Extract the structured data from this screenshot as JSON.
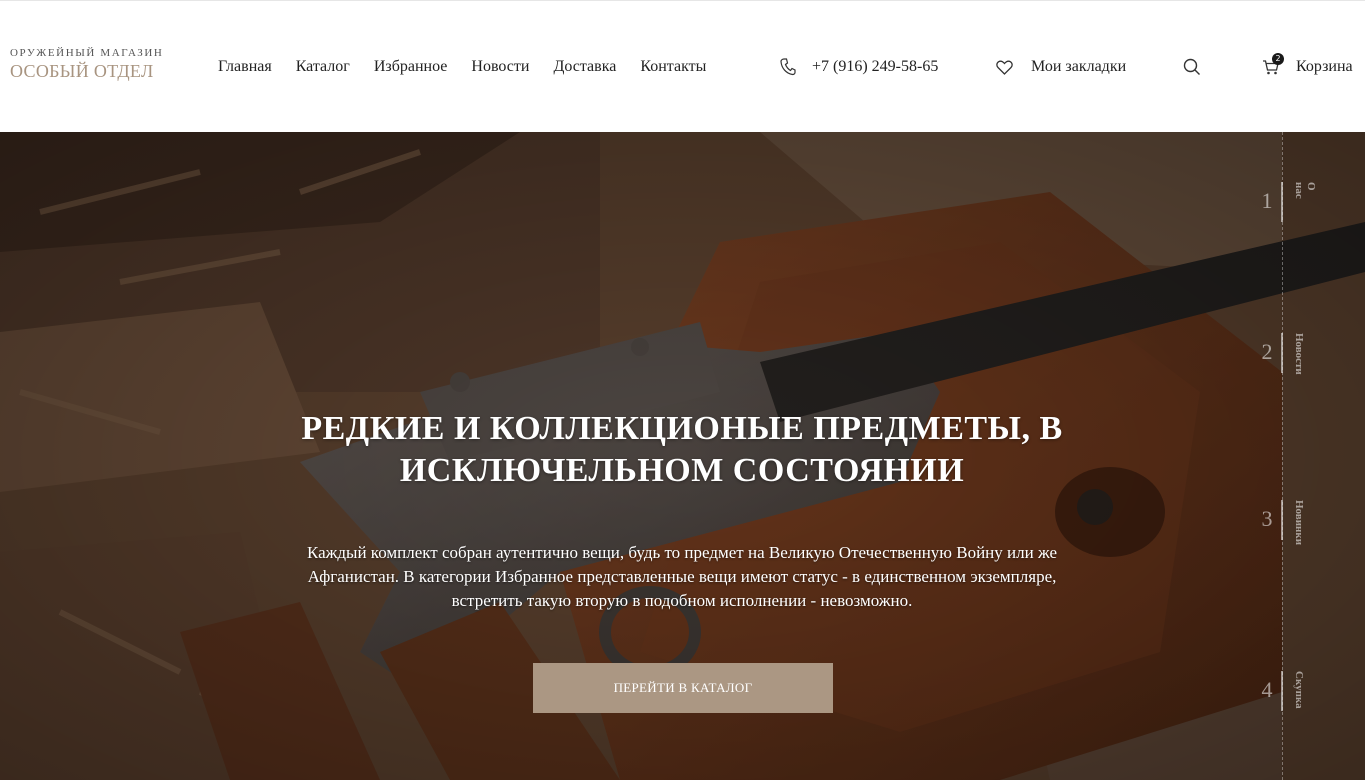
{
  "header": {
    "logo_top": "ОРУЖЕЙНЫЙ МАГАЗИН",
    "logo_main": "ОСОБЫЙ ОТДЕЛ",
    "nav": [
      "Главная",
      "Каталог",
      "Избранное",
      "Новости",
      "Доставка",
      "Контакты"
    ],
    "phone": "+7 (916) 249-58-65",
    "bookmarks_label": "Мои закладки",
    "cart_label": "Корзина",
    "cart_count": "2"
  },
  "hero": {
    "title": "РЕДКИЕ И КОЛЛЕКЦИОНЫЕ ПРЕДМЕТЫ, В ИСКЛЮЧЕЛЬНОМ СОСТОЯНИИ",
    "text": "Каждый комплект собран аутентично вещи, будь то предмет на Великую Отечественную Войну или же Афганистан. В категории Избранное представленные вещи имеют статус - в единственном экземпляре, встретить такую вторую в подобном исполнении - невозможно.",
    "button": "ПЕРЕЙТИ В КАТАЛОГ"
  },
  "pager": [
    {
      "num": "1",
      "label": "О нас"
    },
    {
      "num": "2",
      "label": "Новости"
    },
    {
      "num": "3",
      "label": "Новинки"
    },
    {
      "num": "4",
      "label": "Скупка"
    }
  ],
  "colors": {
    "accent": "#ab9783",
    "logo": "#a89480"
  }
}
